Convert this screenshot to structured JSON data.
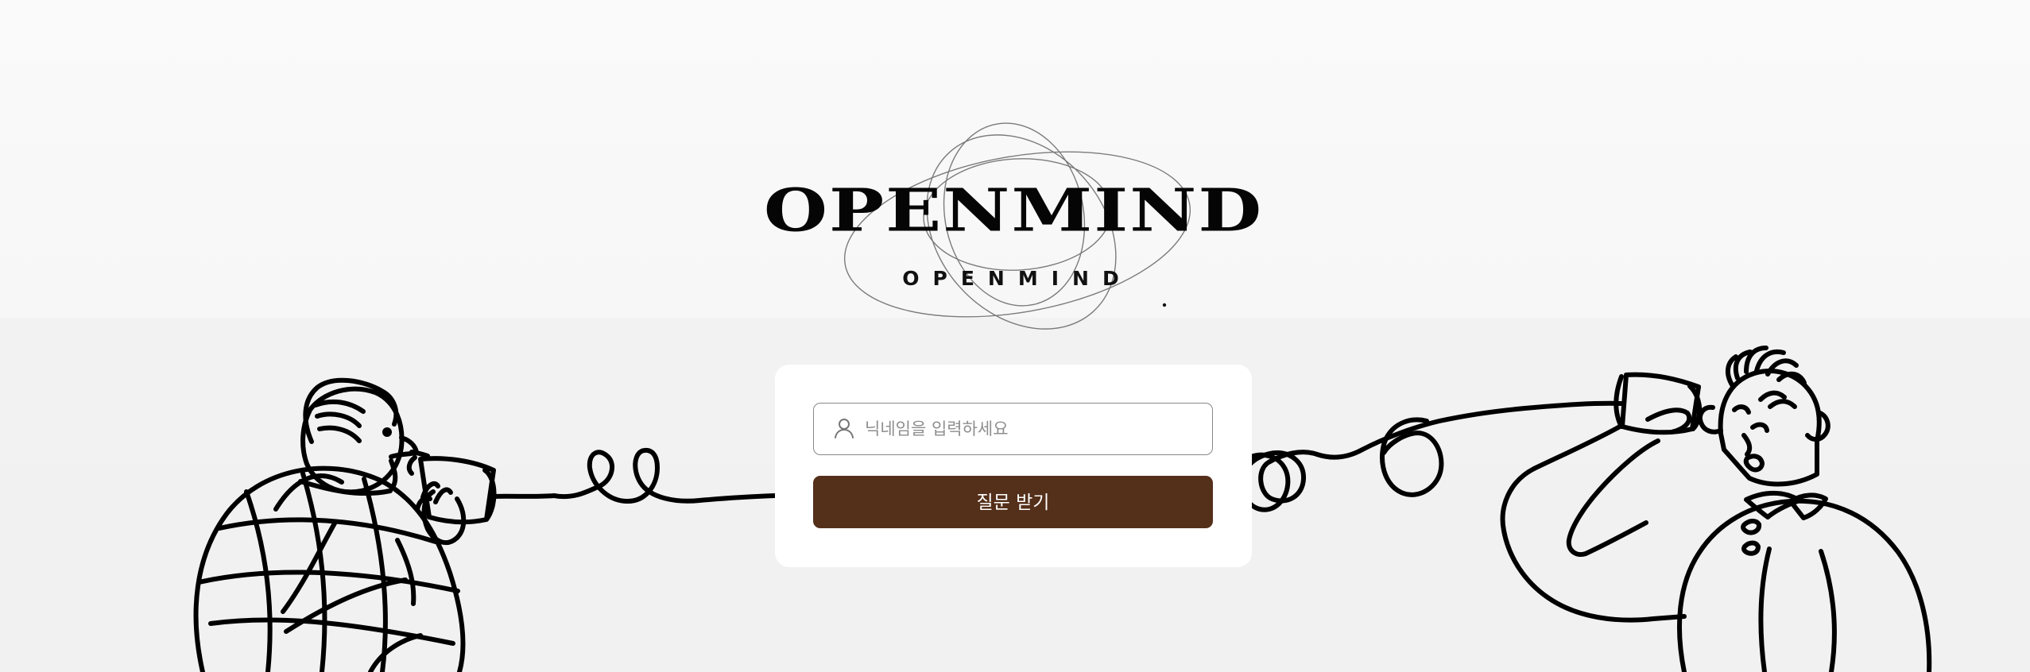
{
  "brand": {
    "logo_text": "OPENMIND",
    "logo_subtext": "OPENMIND"
  },
  "login_form": {
    "nickname_placeholder": "닉네임을 입력하세요",
    "nickname_value": "",
    "submit_label": "질문 받기"
  },
  "icons": {
    "nickname": "person-icon"
  },
  "colors": {
    "background": "#f8f8f8",
    "card": "#ffffff",
    "button": "#542f1a",
    "button_text": "#ffffff",
    "input_border": "#888888",
    "illustration": "#000000"
  }
}
